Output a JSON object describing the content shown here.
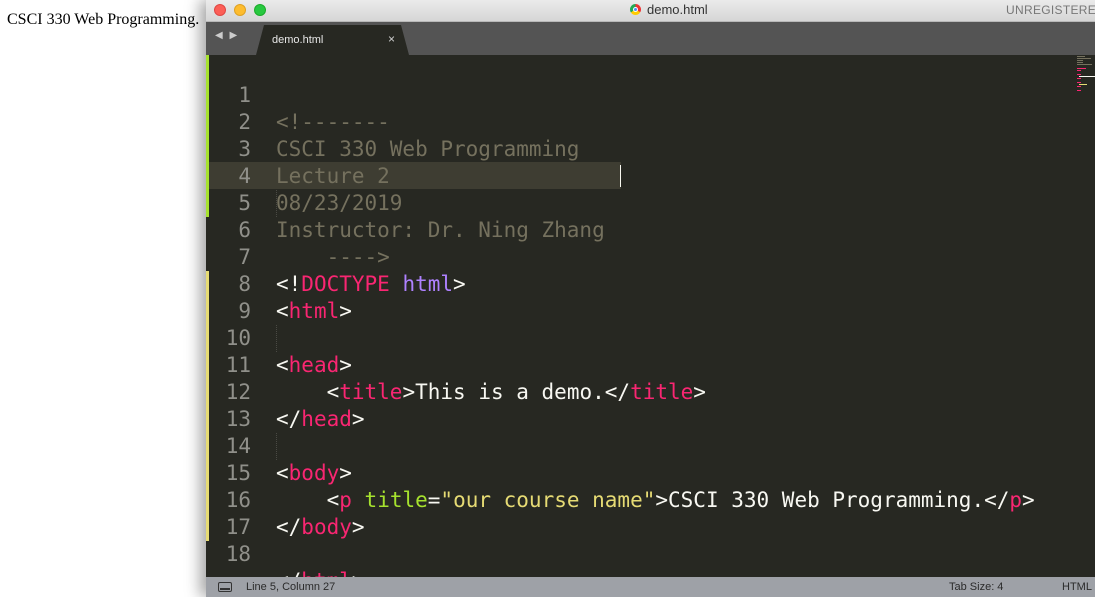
{
  "browser_page": {
    "text": "CSCI 330 Web Programming."
  },
  "window": {
    "title": "demo.html",
    "registration_notice": "UNREGISTERED"
  },
  "tabs": [
    {
      "label": "demo.html",
      "close": "×"
    }
  ],
  "nav": {
    "arrows": "◀ ▶"
  },
  "editor": {
    "line_numbers": [
      "1",
      "2",
      "3",
      "4",
      "5",
      "6",
      "7",
      "8",
      "9",
      "10",
      "11",
      "12",
      "13",
      "14",
      "15",
      "16",
      "17",
      "18"
    ],
    "lines": {
      "l1": {
        "comment": "<!-------"
      },
      "l2": {
        "comment": "CSCI 330 Web Programming"
      },
      "l3": {
        "comment": "Lecture 2"
      },
      "l4": {
        "comment": "08/23/2019"
      },
      "l5": {
        "comment": "Instructor: Dr. Ning Zhang"
      },
      "l6": {
        "comment": "    ---->"
      },
      "l7": {
        "open": "<!",
        "doctype": "DOCTYPE",
        "space": " ",
        "html": "html",
        "close": ">"
      },
      "l8": {
        "open": "<",
        "tag": "html",
        "close": ">"
      },
      "l10": {
        "open": "<",
        "tag": "head",
        "close": ">"
      },
      "l11": {
        "indent": "    ",
        "open": "<",
        "tag": "title",
        "close": ">",
        "text": "This is a demo.",
        "open2": "</",
        "tag2": "title",
        "close2": ">"
      },
      "l12": {
        "open": "</",
        "tag": "head",
        "close": ">"
      },
      "l14": {
        "open": "<",
        "tag": "body",
        "close": ">"
      },
      "l15": {
        "indent": "    ",
        "open": "<",
        "tag": "p",
        "space": " ",
        "attr": "title",
        "eq": "=",
        "value": "\"our course name\"",
        "close": ">",
        "text": "CSCI 330 Web Programming.",
        "open2": "</",
        "tag2": "p",
        "close2": ">"
      },
      "l16": {
        "open": "</",
        "tag": "body",
        "close": ">"
      },
      "l18": {
        "open": "</",
        "tag": "html",
        "close": ">"
      }
    }
  },
  "statusbar": {
    "position": "Line 5, Column 27",
    "tab_size": "Tab Size: 4",
    "syntax": "HTML"
  },
  "colors": {
    "editor_bg": "#272822",
    "comment": "#75715e",
    "tag": "#f92672",
    "attribute": "#a6e22e",
    "string": "#e6db74",
    "keyword": "#ae81ff",
    "plain": "#f8f8f2"
  }
}
